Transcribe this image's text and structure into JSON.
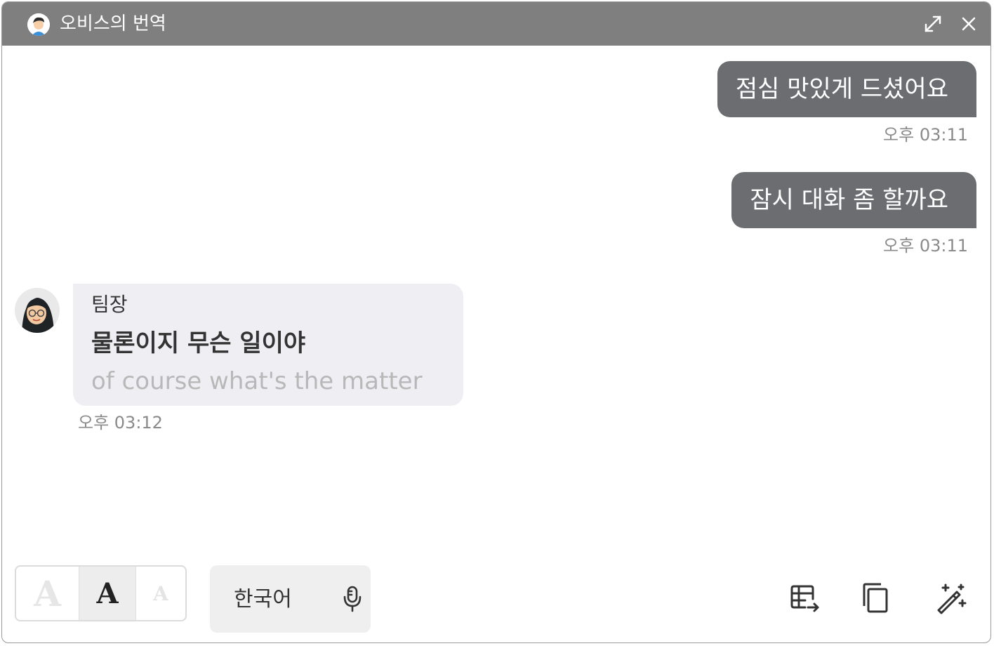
{
  "window": {
    "title": "오비스의 번역",
    "icons": {
      "avatar": "user-avatar-icon",
      "expand": "expand-icon",
      "close": "close-icon"
    }
  },
  "messages": [
    {
      "direction": "outgoing",
      "text": "점심 맛있게 드셨어요",
      "time": "오후 03:11"
    },
    {
      "direction": "outgoing",
      "text": "잠시 대화 좀 할까요",
      "time": "오후 03:11"
    },
    {
      "direction": "incoming",
      "sender": "팀장",
      "text": "물론이지 무슨 일이야",
      "translation": "of course what's the matter",
      "time": "오후 03:12"
    }
  ],
  "toolbar": {
    "font_sizes": [
      "A",
      "A",
      "A"
    ],
    "selected_font_size": "medium",
    "language": "한국어",
    "icons": [
      "microphone-icon",
      "table-export-icon",
      "copy-icon",
      "magic-wand-icon"
    ]
  },
  "colors": {
    "titlebar": "#7f7f7f",
    "outgoing_bubble": "#6b6d70",
    "incoming_bubble": "#efeef3",
    "translation_text": "#b8b8b8"
  }
}
